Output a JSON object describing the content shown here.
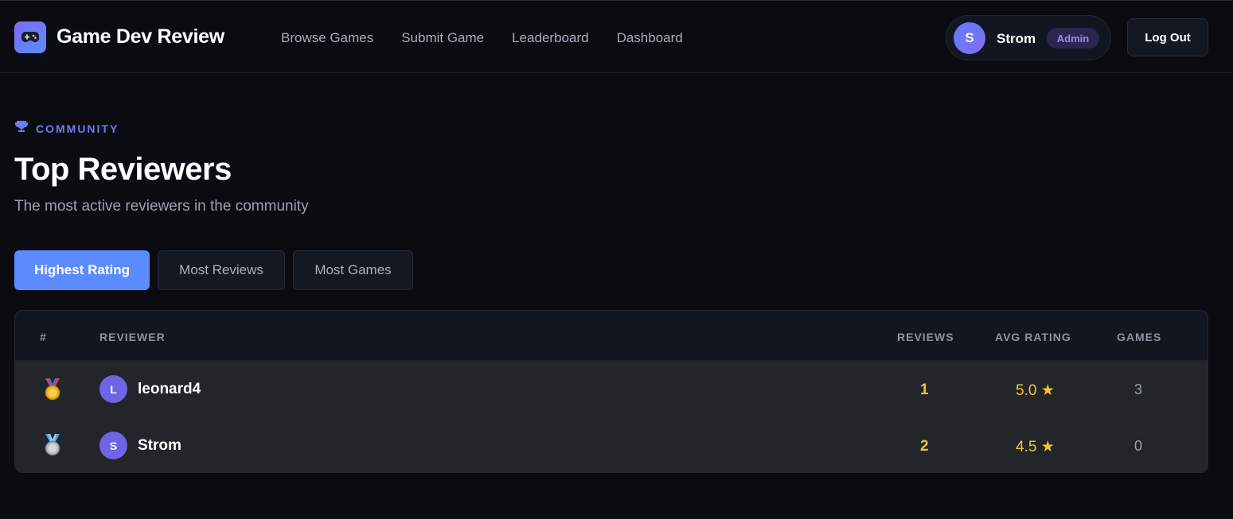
{
  "header": {
    "brand": "Game Dev Review",
    "nav": [
      "Browse Games",
      "Submit Game",
      "Leaderboard",
      "Dashboard"
    ],
    "user": {
      "initial": "S",
      "name": "Strom",
      "role": "Admin"
    },
    "logout_label": "Log Out"
  },
  "section": {
    "eyebrow": "COMMUNITY",
    "title": "Top Reviewers",
    "subtitle": "The most active reviewers in the community"
  },
  "tabs": [
    {
      "label": "Highest Rating",
      "active": true
    },
    {
      "label": "Most Reviews",
      "active": false
    },
    {
      "label": "Most Games",
      "active": false
    }
  ],
  "table": {
    "columns": [
      "#",
      "REVIEWER",
      "REVIEWS",
      "AVG RATING",
      "GAMES"
    ],
    "rows": [
      {
        "medal": "gold-medal-icon",
        "initial": "L",
        "name": "leonard4",
        "reviews": "1",
        "avg_rating": "5.0 ★",
        "games": "3"
      },
      {
        "medal": "silver-medal-icon",
        "initial": "S",
        "name": "Strom",
        "reviews": "2",
        "avg_rating": "4.5 ★",
        "games": "0"
      }
    ]
  },
  "colors": {
    "accent": "#5b8cff",
    "eyebrow": "#6d7cf0",
    "gold_text": "#f5c430",
    "admin_badge": "#2b2550"
  }
}
